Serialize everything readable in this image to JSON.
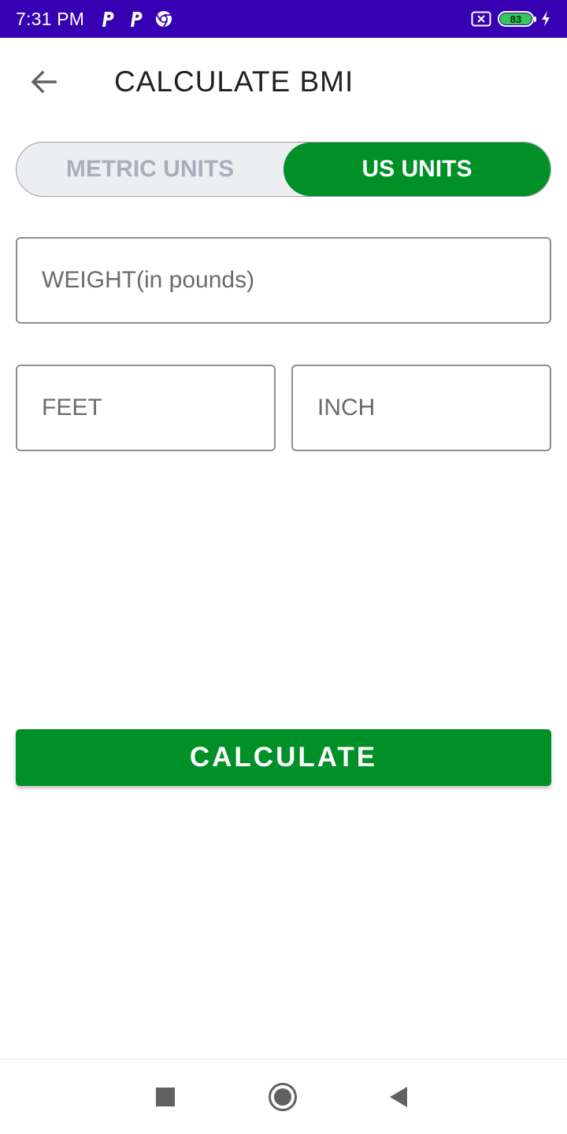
{
  "status_bar": {
    "time": "7:31 PM",
    "notification_icons": [
      "p-app-icon",
      "p-app-icon",
      "chrome-icon"
    ],
    "battery_level": "83",
    "icons_right": [
      "no-sim-icon",
      "battery-icon",
      "charging-bolt-icon"
    ],
    "background_color": "#3700b3"
  },
  "toolbar": {
    "back_icon": "arrow-left-icon",
    "title": "CALCULATE BMI"
  },
  "unit_toggle": {
    "options": [
      {
        "label": "METRIC UNITS",
        "selected": false
      },
      {
        "label": "US UNITS",
        "selected": true
      }
    ],
    "active_color": "#009028"
  },
  "form": {
    "weight_placeholder": "WEIGHT(in pounds)",
    "weight_value": "",
    "feet_placeholder": "FEET",
    "feet_value": "",
    "inch_placeholder": "INCH",
    "inch_value": ""
  },
  "calculate_button": {
    "label": "CALCULATE",
    "color": "#009028"
  },
  "nav_bar": {
    "buttons": [
      "recents-square-icon",
      "home-circle-icon",
      "back-triangle-icon"
    ]
  }
}
